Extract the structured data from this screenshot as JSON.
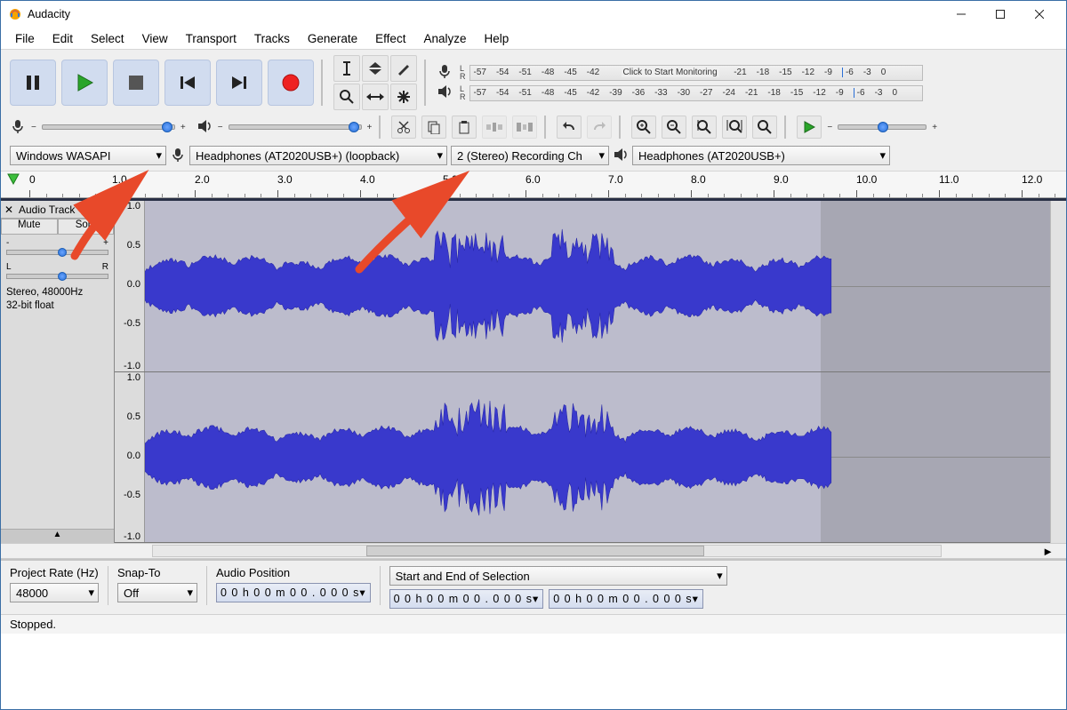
{
  "window": {
    "title": "Audacity"
  },
  "menu": [
    "File",
    "Edit",
    "Select",
    "View",
    "Transport",
    "Tracks",
    "Generate",
    "Effect",
    "Analyze",
    "Help"
  ],
  "transport": {
    "pause": "pause",
    "play": "play",
    "stop": "stop",
    "skip_start": "skip-start",
    "skip_end": "skip-end",
    "record": "record"
  },
  "meter": {
    "ticks": [
      "-57",
      "-54",
      "-51",
      "-48",
      "-45",
      "-42",
      "-39",
      "-36",
      "-33",
      "-30",
      "-27",
      "-24",
      "-21",
      "-18",
      "-15",
      "-12",
      "-9",
      "-6",
      "-3",
      "0"
    ],
    "click_text": "Click to Start Monitoring"
  },
  "devices": {
    "host": "Windows WASAPI",
    "rec_device": "Headphones (AT2020USB+) (loopback)",
    "rec_channels": "2 (Stereo) Recording Ch",
    "play_device": "Headphones (AT2020USB+)"
  },
  "timeline_ticks": [
    "0",
    "1.0",
    "2.0",
    "3.0",
    "4.0",
    "5.0",
    "6.0",
    "7.0",
    "8.0",
    "9.0",
    "10.0",
    "11.0",
    "12.0"
  ],
  "track": {
    "name": "Audio Track",
    "mute": "Mute",
    "solo": "Solo",
    "gain_minus": "-",
    "gain_plus": "+",
    "pan_l": "L",
    "pan_r": "R",
    "info_line1": "Stereo, 48000Hz",
    "info_line2": "32-bit float",
    "y_ticks": [
      "1.0",
      "0.5",
      "0.0",
      "-0.5",
      "-1.0"
    ]
  },
  "selection": {
    "project_rate_label": "Project Rate (Hz)",
    "project_rate": "48000",
    "snap_label": "Snap-To",
    "snap_value": "Off",
    "audio_pos_label": "Audio Position",
    "audio_pos_value": "0 0 h 0 0 m 0 0 . 0 0 0 s",
    "sel_mode_label": "Start and End of Selection",
    "sel_start": "0 0 h 0 0 m 0 0 . 0 0 0 s",
    "sel_end": "0 0 h 0 0 m 0 0 . 0 0 0 s"
  },
  "status": "Stopped."
}
